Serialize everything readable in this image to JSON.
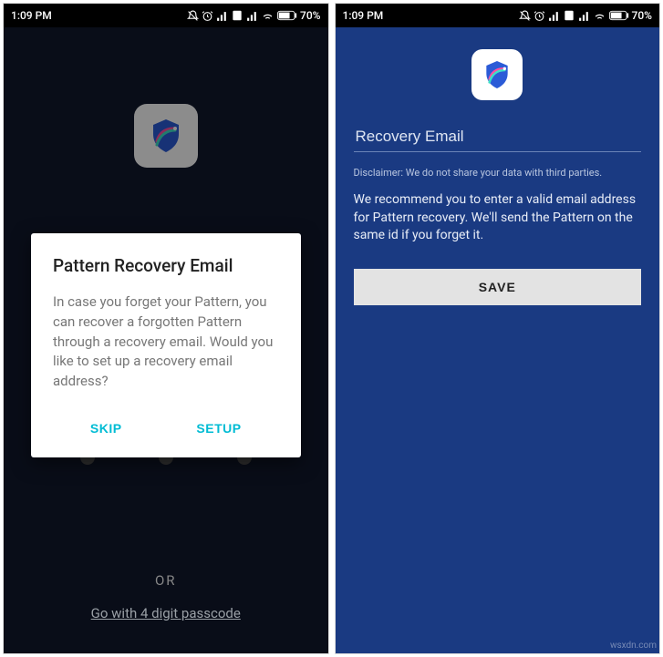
{
  "status": {
    "time": "1:09 PM",
    "battery": "70%"
  },
  "left": {
    "dialog": {
      "title": "Pattern Recovery Email",
      "body": "In case you forget your Pattern, you can recover a forgotten Pattern through a recovery email. Would you like to set up a recovery email address?",
      "skip": "SKIP",
      "setup": "SETUP"
    },
    "or": "OR",
    "passcode_link": "Go with 4 digit passcode"
  },
  "right": {
    "placeholder": "Recovery Email",
    "disclaimer": "Disclaimer: We do not share your data with third parties.",
    "recommend": "We recommend you to enter a valid email address for Pattern recovery. We'll send the Pattern on the same id if you forget it.",
    "save": "SAVE"
  },
  "watermark": "wsxdn.com"
}
